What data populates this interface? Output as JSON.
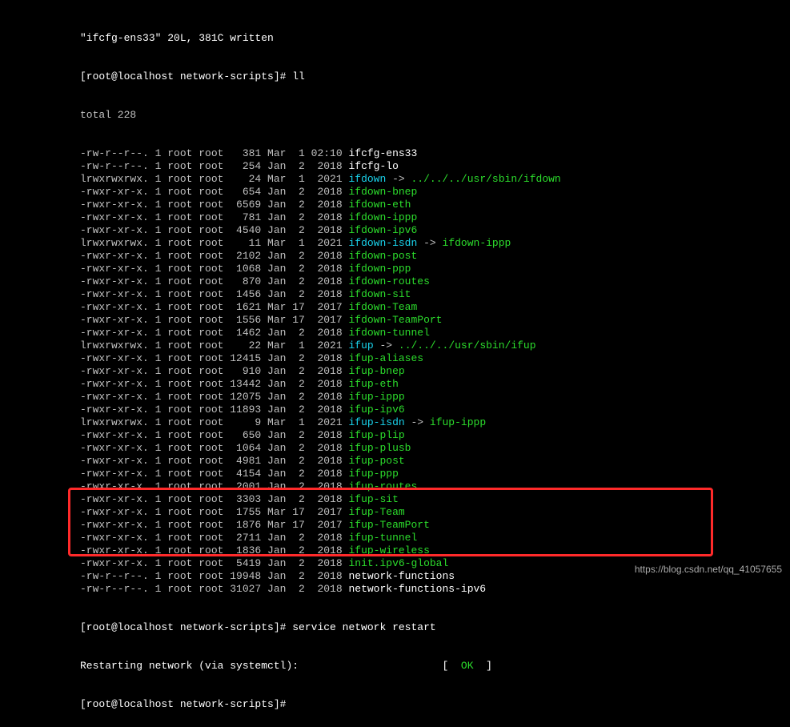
{
  "header": {
    "vim_msg": "\"ifcfg-ens33\" 20L, 381C written",
    "prompt1": "[root@localhost network-scripts]# ll",
    "total": "total 228"
  },
  "listing": [
    {
      "perm": "-rw-r--r--.",
      "links": "1",
      "owner": "root",
      "group": "root",
      "size": "381",
      "mon": "Mar",
      "day": "1",
      "yt": "02:10",
      "name": "ifcfg-ens33",
      "cls": "white",
      "link_arrow": "",
      "link_tgt": "",
      "link_cls": ""
    },
    {
      "perm": "-rw-r--r--.",
      "links": "1",
      "owner": "root",
      "group": "root",
      "size": "254",
      "mon": "Jan",
      "day": "2",
      "yt": "2018",
      "name": "ifcfg-lo",
      "cls": "white",
      "link_arrow": "",
      "link_tgt": "",
      "link_cls": ""
    },
    {
      "perm": "lrwxrwxrwx.",
      "links": "1",
      "owner": "root",
      "group": "root",
      "size": "24",
      "mon": "Mar",
      "day": "1",
      "yt": "2021",
      "name": "ifdown",
      "cls": "cyan",
      "link_arrow": " -> ",
      "link_tgt": "../../../usr/sbin/ifdown",
      "link_cls": "green"
    },
    {
      "perm": "-rwxr-xr-x.",
      "links": "1",
      "owner": "root",
      "group": "root",
      "size": "654",
      "mon": "Jan",
      "day": "2",
      "yt": "2018",
      "name": "ifdown-bnep",
      "cls": "green",
      "link_arrow": "",
      "link_tgt": "",
      "link_cls": ""
    },
    {
      "perm": "-rwxr-xr-x.",
      "links": "1",
      "owner": "root",
      "group": "root",
      "size": "6569",
      "mon": "Jan",
      "day": "2",
      "yt": "2018",
      "name": "ifdown-eth",
      "cls": "green",
      "link_arrow": "",
      "link_tgt": "",
      "link_cls": ""
    },
    {
      "perm": "-rwxr-xr-x.",
      "links": "1",
      "owner": "root",
      "group": "root",
      "size": "781",
      "mon": "Jan",
      "day": "2",
      "yt": "2018",
      "name": "ifdown-ippp",
      "cls": "green",
      "link_arrow": "",
      "link_tgt": "",
      "link_cls": ""
    },
    {
      "perm": "-rwxr-xr-x.",
      "links": "1",
      "owner": "root",
      "group": "root",
      "size": "4540",
      "mon": "Jan",
      "day": "2",
      "yt": "2018",
      "name": "ifdown-ipv6",
      "cls": "green",
      "link_arrow": "",
      "link_tgt": "",
      "link_cls": ""
    },
    {
      "perm": "lrwxrwxrwx.",
      "links": "1",
      "owner": "root",
      "group": "root",
      "size": "11",
      "mon": "Mar",
      "day": "1",
      "yt": "2021",
      "name": "ifdown-isdn",
      "cls": "cyan",
      "link_arrow": " -> ",
      "link_tgt": "ifdown-ippp",
      "link_cls": "green"
    },
    {
      "perm": "-rwxr-xr-x.",
      "links": "1",
      "owner": "root",
      "group": "root",
      "size": "2102",
      "mon": "Jan",
      "day": "2",
      "yt": "2018",
      "name": "ifdown-post",
      "cls": "green",
      "link_arrow": "",
      "link_tgt": "",
      "link_cls": ""
    },
    {
      "perm": "-rwxr-xr-x.",
      "links": "1",
      "owner": "root",
      "group": "root",
      "size": "1068",
      "mon": "Jan",
      "day": "2",
      "yt": "2018",
      "name": "ifdown-ppp",
      "cls": "green",
      "link_arrow": "",
      "link_tgt": "",
      "link_cls": ""
    },
    {
      "perm": "-rwxr-xr-x.",
      "links": "1",
      "owner": "root",
      "group": "root",
      "size": "870",
      "mon": "Jan",
      "day": "2",
      "yt": "2018",
      "name": "ifdown-routes",
      "cls": "green",
      "link_arrow": "",
      "link_tgt": "",
      "link_cls": ""
    },
    {
      "perm": "-rwxr-xr-x.",
      "links": "1",
      "owner": "root",
      "group": "root",
      "size": "1456",
      "mon": "Jan",
      "day": "2",
      "yt": "2018",
      "name": "ifdown-sit",
      "cls": "green",
      "link_arrow": "",
      "link_tgt": "",
      "link_cls": ""
    },
    {
      "perm": "-rwxr-xr-x.",
      "links": "1",
      "owner": "root",
      "group": "root",
      "size": "1621",
      "mon": "Mar",
      "day": "17",
      "yt": "2017",
      "name": "ifdown-Team",
      "cls": "green",
      "link_arrow": "",
      "link_tgt": "",
      "link_cls": ""
    },
    {
      "perm": "-rwxr-xr-x.",
      "links": "1",
      "owner": "root",
      "group": "root",
      "size": "1556",
      "mon": "Mar",
      "day": "17",
      "yt": "2017",
      "name": "ifdown-TeamPort",
      "cls": "green",
      "link_arrow": "",
      "link_tgt": "",
      "link_cls": ""
    },
    {
      "perm": "-rwxr-xr-x.",
      "links": "1",
      "owner": "root",
      "group": "root",
      "size": "1462",
      "mon": "Jan",
      "day": "2",
      "yt": "2018",
      "name": "ifdown-tunnel",
      "cls": "green",
      "link_arrow": "",
      "link_tgt": "",
      "link_cls": ""
    },
    {
      "perm": "lrwxrwxrwx.",
      "links": "1",
      "owner": "root",
      "group": "root",
      "size": "22",
      "mon": "Mar",
      "day": "1",
      "yt": "2021",
      "name": "ifup",
      "cls": "cyan",
      "link_arrow": " -> ",
      "link_tgt": "../../../usr/sbin/ifup",
      "link_cls": "green"
    },
    {
      "perm": "-rwxr-xr-x.",
      "links": "1",
      "owner": "root",
      "group": "root",
      "size": "12415",
      "mon": "Jan",
      "day": "2",
      "yt": "2018",
      "name": "ifup-aliases",
      "cls": "green",
      "link_arrow": "",
      "link_tgt": "",
      "link_cls": ""
    },
    {
      "perm": "-rwxr-xr-x.",
      "links": "1",
      "owner": "root",
      "group": "root",
      "size": "910",
      "mon": "Jan",
      "day": "2",
      "yt": "2018",
      "name": "ifup-bnep",
      "cls": "green",
      "link_arrow": "",
      "link_tgt": "",
      "link_cls": ""
    },
    {
      "perm": "-rwxr-xr-x.",
      "links": "1",
      "owner": "root",
      "group": "root",
      "size": "13442",
      "mon": "Jan",
      "day": "2",
      "yt": "2018",
      "name": "ifup-eth",
      "cls": "green",
      "link_arrow": "",
      "link_tgt": "",
      "link_cls": ""
    },
    {
      "perm": "-rwxr-xr-x.",
      "links": "1",
      "owner": "root",
      "group": "root",
      "size": "12075",
      "mon": "Jan",
      "day": "2",
      "yt": "2018",
      "name": "ifup-ippp",
      "cls": "green",
      "link_arrow": "",
      "link_tgt": "",
      "link_cls": ""
    },
    {
      "perm": "-rwxr-xr-x.",
      "links": "1",
      "owner": "root",
      "group": "root",
      "size": "11893",
      "mon": "Jan",
      "day": "2",
      "yt": "2018",
      "name": "ifup-ipv6",
      "cls": "green",
      "link_arrow": "",
      "link_tgt": "",
      "link_cls": ""
    },
    {
      "perm": "lrwxrwxrwx.",
      "links": "1",
      "owner": "root",
      "group": "root",
      "size": "9",
      "mon": "Mar",
      "day": "1",
      "yt": "2021",
      "name": "ifup-isdn",
      "cls": "cyan",
      "link_arrow": " -> ",
      "link_tgt": "ifup-ippp",
      "link_cls": "green"
    },
    {
      "perm": "-rwxr-xr-x.",
      "links": "1",
      "owner": "root",
      "group": "root",
      "size": "650",
      "mon": "Jan",
      "day": "2",
      "yt": "2018",
      "name": "ifup-plip",
      "cls": "green",
      "link_arrow": "",
      "link_tgt": "",
      "link_cls": ""
    },
    {
      "perm": "-rwxr-xr-x.",
      "links": "1",
      "owner": "root",
      "group": "root",
      "size": "1064",
      "mon": "Jan",
      "day": "2",
      "yt": "2018",
      "name": "ifup-plusb",
      "cls": "green",
      "link_arrow": "",
      "link_tgt": "",
      "link_cls": ""
    },
    {
      "perm": "-rwxr-xr-x.",
      "links": "1",
      "owner": "root",
      "group": "root",
      "size": "4981",
      "mon": "Jan",
      "day": "2",
      "yt": "2018",
      "name": "ifup-post",
      "cls": "green",
      "link_arrow": "",
      "link_tgt": "",
      "link_cls": ""
    },
    {
      "perm": "-rwxr-xr-x.",
      "links": "1",
      "owner": "root",
      "group": "root",
      "size": "4154",
      "mon": "Jan",
      "day": "2",
      "yt": "2018",
      "name": "ifup-ppp",
      "cls": "green",
      "link_arrow": "",
      "link_tgt": "",
      "link_cls": ""
    },
    {
      "perm": "-rwxr-xr-x.",
      "links": "1",
      "owner": "root",
      "group": "root",
      "size": "2001",
      "mon": "Jan",
      "day": "2",
      "yt": "2018",
      "name": "ifup-routes",
      "cls": "green",
      "link_arrow": "",
      "link_tgt": "",
      "link_cls": ""
    },
    {
      "perm": "-rwxr-xr-x.",
      "links": "1",
      "owner": "root",
      "group": "root",
      "size": "3303",
      "mon": "Jan",
      "day": "2",
      "yt": "2018",
      "name": "ifup-sit",
      "cls": "green",
      "link_arrow": "",
      "link_tgt": "",
      "link_cls": ""
    },
    {
      "perm": "-rwxr-xr-x.",
      "links": "1",
      "owner": "root",
      "group": "root",
      "size": "1755",
      "mon": "Mar",
      "day": "17",
      "yt": "2017",
      "name": "ifup-Team",
      "cls": "green",
      "link_arrow": "",
      "link_tgt": "",
      "link_cls": ""
    },
    {
      "perm": "-rwxr-xr-x.",
      "links": "1",
      "owner": "root",
      "group": "root",
      "size": "1876",
      "mon": "Mar",
      "day": "17",
      "yt": "2017",
      "name": "ifup-TeamPort",
      "cls": "green",
      "link_arrow": "",
      "link_tgt": "",
      "link_cls": ""
    },
    {
      "perm": "-rwxr-xr-x.",
      "links": "1",
      "owner": "root",
      "group": "root",
      "size": "2711",
      "mon": "Jan",
      "day": "2",
      "yt": "2018",
      "name": "ifup-tunnel",
      "cls": "green",
      "link_arrow": "",
      "link_tgt": "",
      "link_cls": ""
    },
    {
      "perm": "-rwxr-xr-x.",
      "links": "1",
      "owner": "root",
      "group": "root",
      "size": "1836",
      "mon": "Jan",
      "day": "2",
      "yt": "2018",
      "name": "ifup-wireless",
      "cls": "green",
      "link_arrow": "",
      "link_tgt": "",
      "link_cls": ""
    },
    {
      "perm": "-rwxr-xr-x.",
      "links": "1",
      "owner": "root",
      "group": "root",
      "size": "5419",
      "mon": "Jan",
      "day": "2",
      "yt": "2018",
      "name": "init.ipv6-global",
      "cls": "green",
      "link_arrow": "",
      "link_tgt": "",
      "link_cls": ""
    },
    {
      "perm": "-rw-r--r--.",
      "links": "1",
      "owner": "root",
      "group": "root",
      "size": "19948",
      "mon": "Jan",
      "day": "2",
      "yt": "2018",
      "name": "network-functions",
      "cls": "white",
      "link_arrow": "",
      "link_tgt": "",
      "link_cls": ""
    },
    {
      "perm": "-rw-r--r--.",
      "links": "1",
      "owner": "root",
      "group": "root",
      "size": "31027",
      "mon": "Jan",
      "day": "2",
      "yt": "2018",
      "name": "network-functions-ipv6",
      "cls": "white",
      "link_arrow": "",
      "link_tgt": "",
      "link_cls": ""
    }
  ],
  "footer": {
    "prompt2": "[root@localhost network-scripts]# service network restart",
    "restart_prefix": "Restarting network (via systemctl):                       [  ",
    "ok": "OK",
    "restart_suffix": "  ]",
    "prompt3": "[root@localhost network-scripts]# "
  },
  "watermark": "https://blog.csdn.net/qq_41057655"
}
